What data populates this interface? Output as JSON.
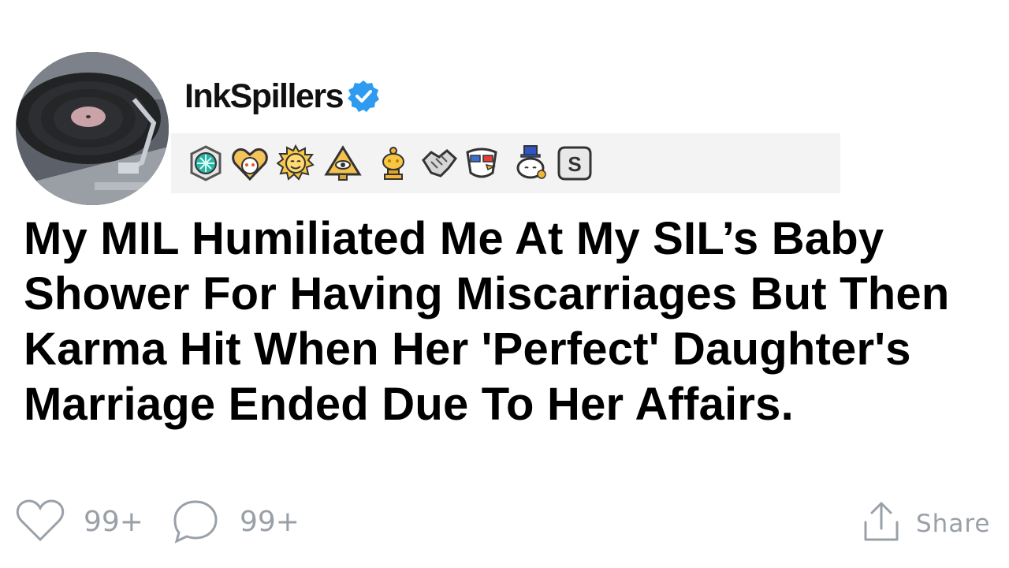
{
  "post": {
    "author": {
      "username": "InkSpillers",
      "avatar_icon": "record-player-avatar",
      "verified_icon": "verified-check-icon",
      "verified_color": "#2f9bf0"
    },
    "awards": [
      {
        "icon": "timeless-beauty-award-icon"
      },
      {
        "icon": "wholesome-heart-award-icon"
      },
      {
        "icon": "sunny-face-award-icon"
      },
      {
        "icon": "illuminati-pyramid-award-icon"
      },
      {
        "icon": "gold-trophy-award-icon"
      },
      {
        "icon": "handshake-award-icon"
      },
      {
        "icon": "eagle-freedom-award-icon"
      },
      {
        "icon": "snoo-tophat-award-icon"
      },
      {
        "icon": "silver-s-award-icon"
      }
    ],
    "title": "My MIL Humiliated Me At My SIL’s Baby Shower For Having Miscarriages But Then Karma Hit When Her 'Perfect' Daughter's Marriage Ended Due To Her Affairs.",
    "actions": {
      "likes": "99+",
      "comments": "99+",
      "share_label": "Share"
    }
  }
}
